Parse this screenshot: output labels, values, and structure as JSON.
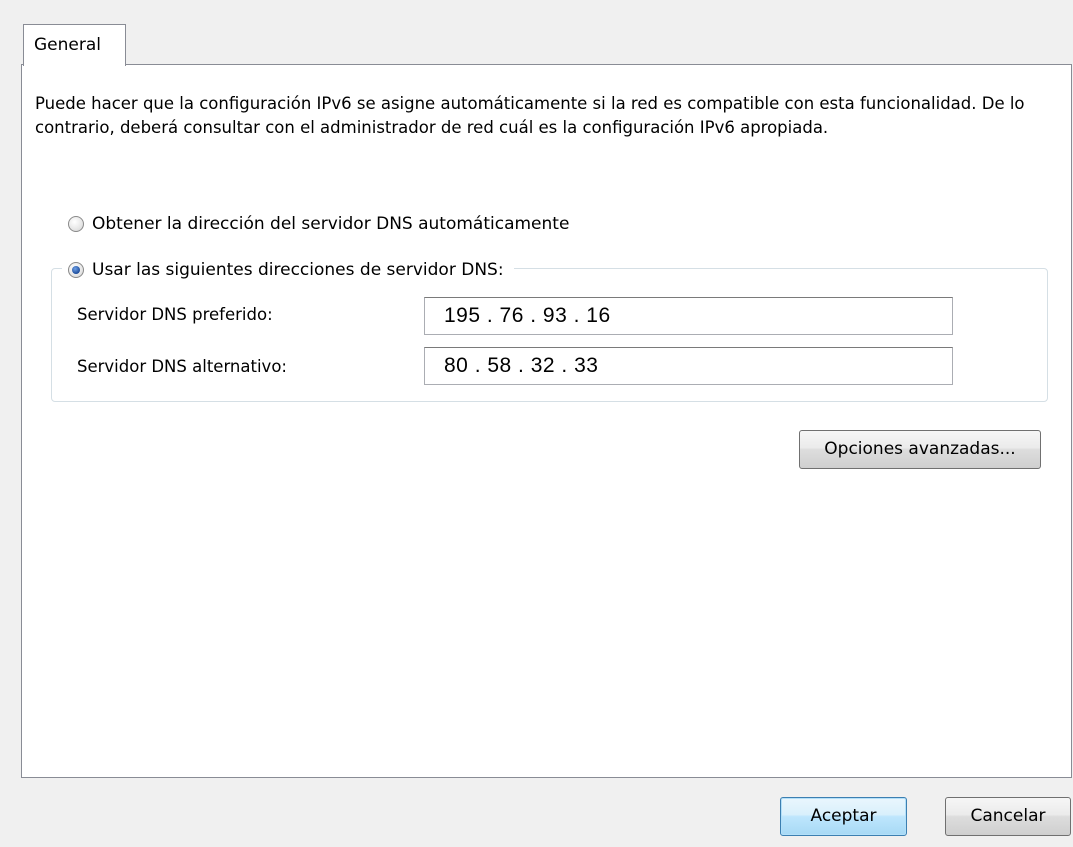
{
  "tabs": [
    {
      "label": "General",
      "active": true
    }
  ],
  "description": "Puede hacer que la configuración IPv6 se asigne automáticamente si la red es compatible con esta funcionalidad. De lo contrario, deberá consultar con el administrador de red cuál es la configuración IPv6 apropiada.",
  "dns": {
    "auto_option": {
      "label": "Obtener la dirección del servidor DNS automáticamente",
      "checked": false
    },
    "manual_option": {
      "label": "Usar las siguientes direcciones de servidor DNS:",
      "checked": true
    },
    "preferred": {
      "label": "Servidor DNS preferido:",
      "value": "195 . 76 . 93 . 16"
    },
    "alternate": {
      "label": "Servidor DNS alternativo:",
      "value": "80 . 58 . 32 . 33"
    }
  },
  "buttons": {
    "advanced": "Opciones avanzadas...",
    "ok": "Aceptar",
    "cancel": "Cancelar"
  },
  "colors": {
    "window_bg": "#f0f0f0",
    "panel_bg": "#ffffff",
    "border": "#898c95",
    "default_button_border": "#3c7fb1"
  }
}
